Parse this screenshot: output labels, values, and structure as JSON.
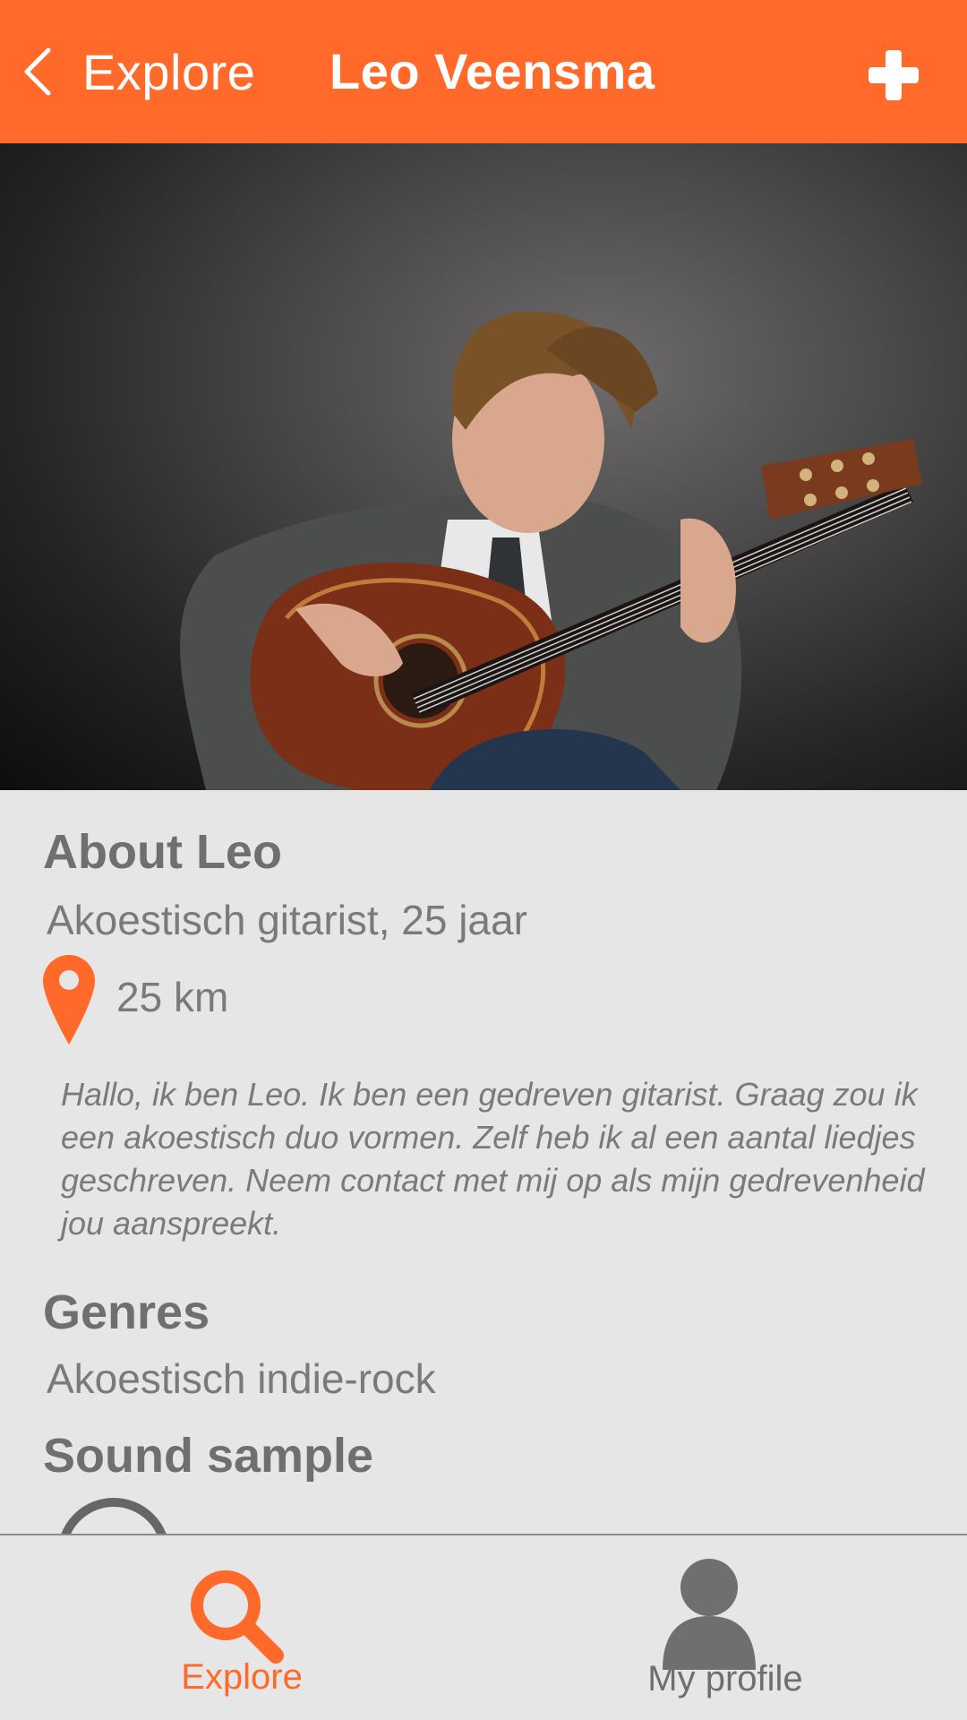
{
  "header": {
    "back_label": "Explore",
    "title": "Leo Veensma",
    "add_icon": "plus-icon",
    "back_icon": "chevron-left-icon"
  },
  "profile": {
    "about_heading": "About Leo",
    "subtitle": "Akoestisch gitarist, 25 jaar",
    "distance": "25 km",
    "location_icon": "map-pin-icon",
    "bio": "Hallo, ik ben Leo. Ik ben een gedreven gitarist. Graag zou ik een akoestisch duo vormen. Zelf heb ik al een aantal liedjes geschreven. Neem contact met mij op als mijn gedrevenheid jou aanspreekt.",
    "genres_heading": "Genres",
    "genres_value": "Akoestisch indie-rock",
    "sound_heading": "Sound sample",
    "sound_icon": "play-circle-icon"
  },
  "tabbar": {
    "explore_label": "Explore",
    "profile_label": "My profile",
    "explore_icon": "search-icon",
    "profile_icon": "user-icon"
  },
  "colors": {
    "accent": "#ff6a2a",
    "background": "#e7e6e6",
    "text": "#7a7a7a",
    "heading": "#6f6f6f"
  }
}
